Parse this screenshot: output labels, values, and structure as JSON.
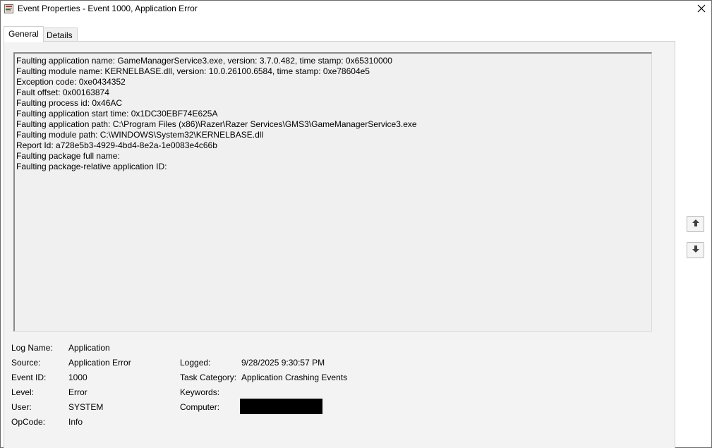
{
  "window": {
    "title": "Event Properties - Event 1000, Application Error",
    "icon": "event-viewer-icon",
    "close_glyph": "✕"
  },
  "tabs": [
    {
      "label": "General",
      "active": true
    },
    {
      "label": "Details",
      "active": false
    }
  ],
  "description": {
    "lines": [
      "Faulting application name: GameManagerService3.exe, version: 3.7.0.482, time stamp: 0x65310000",
      "Faulting module name: KERNELBASE.dll, version: 10.0.26100.6584, time stamp: 0xe78604e5",
      "Exception code: 0xe0434352",
      "Fault offset: 0x00163874",
      "Faulting process id: 0x46AC",
      "Faulting application start time: 0x1DC30EBF74E625A",
      "Faulting application path: C:\\Program Files (x86)\\Razer\\Razer Services\\GMS3\\GameManagerService3.exe",
      "Faulting module path: C:\\WINDOWS\\System32\\KERNELBASE.dll",
      "Report Id: a728e5b3-4929-4bd4-8e2a-1e0083e4c66b",
      "Faulting package full name:",
      "Faulting package-relative application ID:"
    ]
  },
  "nav": {
    "up_icon": "arrow-up-icon",
    "down_icon": "arrow-down-icon"
  },
  "fields": {
    "log_name": {
      "label": "Log Name:",
      "value": "Application"
    },
    "source": {
      "label": "Source:",
      "value": "Application Error"
    },
    "event_id": {
      "label": "Event ID:",
      "value": "1000"
    },
    "level": {
      "label": "Level:",
      "value": "Error"
    },
    "user": {
      "label": "User:",
      "value": "SYSTEM"
    },
    "opcode": {
      "label": "OpCode:",
      "value": "Info"
    },
    "logged": {
      "label": "Logged:",
      "value": "9/28/2025 9:30:57 PM"
    },
    "task_category": {
      "label": "Task Category:",
      "value": "Application Crashing Events"
    },
    "keywords": {
      "label": "Keywords:",
      "value": ""
    },
    "computer": {
      "label": "Computer:",
      "value": ""
    }
  },
  "colors": {
    "panel_bg": "#f3f3f3",
    "redaction": "#000000"
  }
}
